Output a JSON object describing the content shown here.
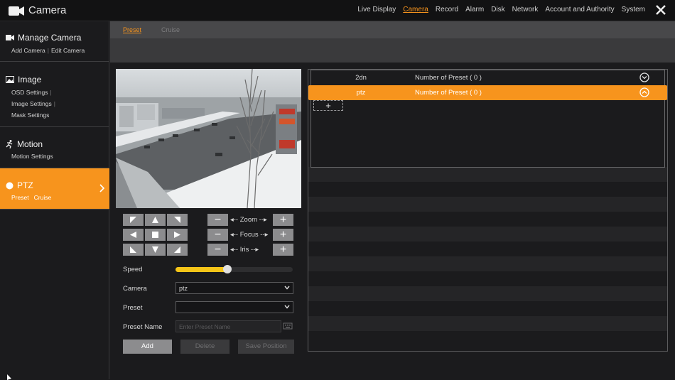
{
  "app": {
    "title": "Camera"
  },
  "topnav": [
    "Live Display",
    "Camera",
    "Record",
    "Alarm",
    "Disk",
    "Network",
    "Account and Authority",
    "System"
  ],
  "topnav_active": "Camera",
  "sidebar": {
    "manage_camera": {
      "title": "Manage Camera",
      "sub1": "Add Camera",
      "sub2": "Edit Camera"
    },
    "image": {
      "title": "Image",
      "sub1": "OSD Settings",
      "sub2": "Image Settings",
      "sub3": "Mask Settings"
    },
    "motion": {
      "title": "Motion",
      "sub1": "Motion Settings"
    },
    "ptz": {
      "title": "PTZ",
      "sub1": "Preset",
      "sub2": "Cruise"
    }
  },
  "tabs": {
    "preset": "Preset",
    "cruise": "Cruise"
  },
  "ptz_controls": {
    "zoom": "Zoom",
    "focus": "Focus",
    "iris": "Iris"
  },
  "form": {
    "speed_label": "Speed",
    "speed_value_fraction": 0.44,
    "camera_label": "Camera",
    "camera_value": "ptz",
    "preset_label": "Preset",
    "preset_value": "",
    "preset_name_label": "Preset Name",
    "preset_name_placeholder": "Enter Preset Name"
  },
  "buttons": {
    "add": "Add",
    "delete": "Delete",
    "save_position": "Save Position"
  },
  "preset_list": [
    {
      "name": "2dn",
      "count": "Number of Preset ( 0 )",
      "selected": false
    },
    {
      "name": "ptz",
      "count": "Number of Preset ( 0 )",
      "selected": true
    }
  ],
  "colors": {
    "accent": "#f7941d",
    "speed": "#f5c518"
  }
}
